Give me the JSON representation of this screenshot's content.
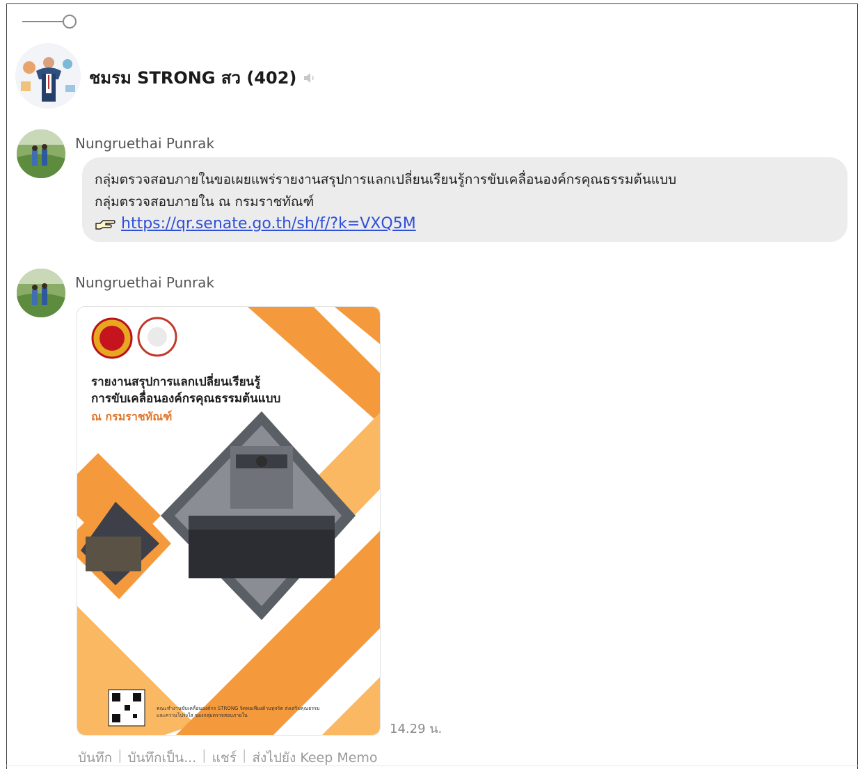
{
  "group": {
    "name": "ชมรม STRONG สว (402)"
  },
  "messages": [
    {
      "sender": "Nungruethai Punrak",
      "text_line1": "กลุ่มตรวจสอบภายในขอเผยแพร่รายงานสรุปการแลกเปลี่ยนเรียนรู้การขับเคลื่อนองค์กรคุณธรรมต้นแบบ",
      "text_line2": "กลุ่มตรวจสอบภายใน ณ กรมราชทัณฑ์",
      "link": "https://qr.senate.go.th/sh/f/?k=VXQ5M"
    },
    {
      "sender": "Nungruethai Punrak",
      "poster": {
        "title_line1": "รายงานสรุปการแลกเปลี่ยนเรียนรู้",
        "title_line2": "การขับเคลื่อนองค์กรคุณธรรมต้นแบบ",
        "subtitle": "ณ กรมราชทัณฑ์",
        "footer": "คณะทำงานขับเคลื่อนองค์กร STRONG จิตพอเพียงต้านทุจริต ส่งเสริมคุณธรรมและความโปร่งใส ของกลุ่มตรวจสอบภายใน"
      },
      "time": "14.29 น.",
      "actions": [
        "บันทึก",
        "บันทึกเป็น...",
        "แชร์",
        "ส่งไปยัง Keep Memo"
      ]
    }
  ],
  "colors": {
    "link": "#2e4fd8",
    "bubble": "#ececec",
    "poster_orange": "#f59a3c",
    "poster_light_orange": "#fbb862"
  },
  "icons": [
    "slider-icon",
    "speaker-muted-icon",
    "pointing-hand-icon"
  ]
}
